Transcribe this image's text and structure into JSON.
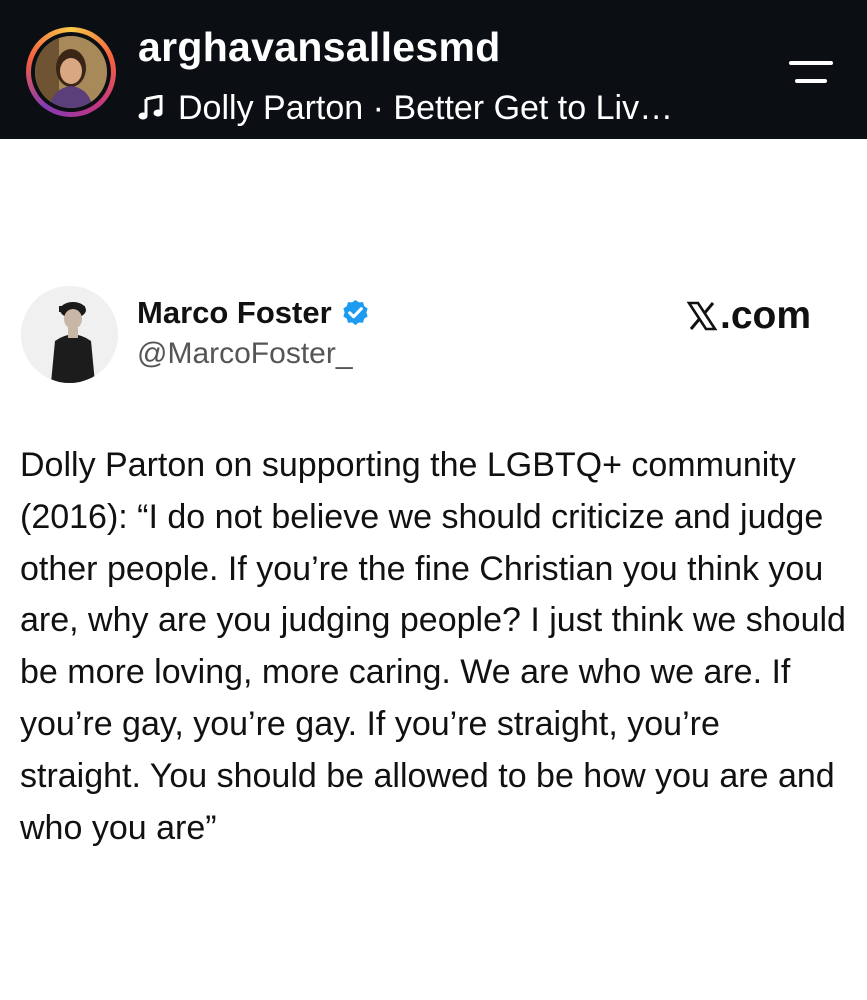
{
  "story_header": {
    "username": "arghavansallesmd",
    "music_text": "Dolly Parton · Better Get to Liv…"
  },
  "tweet": {
    "author_name": "Marco Foster",
    "handle": "@MarcoFoster_",
    "source": ".com",
    "text": "Dolly Parton on supporting the LGBTQ+ community (2016): “I do not believe we should criticize and judge other people. If you’re the fine Christian you think you are, why are you judging people? I just think we should be more loving, more caring. We are who we are. If you’re gay, you’re gay. If you’re straight, you’re straight. You should be allowed to be how you are and who you are”"
  },
  "icons": {
    "story_avatar": "profile-photo-icon",
    "music": "music-note-icon",
    "menu": "menu-icon",
    "tweet_avatar": "profile-photo-icon",
    "verified": "verified-badge-icon",
    "x_logo": "x-logo-icon"
  },
  "colors": {
    "header_bg": "#0b0f14",
    "verified_blue": "#1d9bf0",
    "text": "#111111"
  }
}
